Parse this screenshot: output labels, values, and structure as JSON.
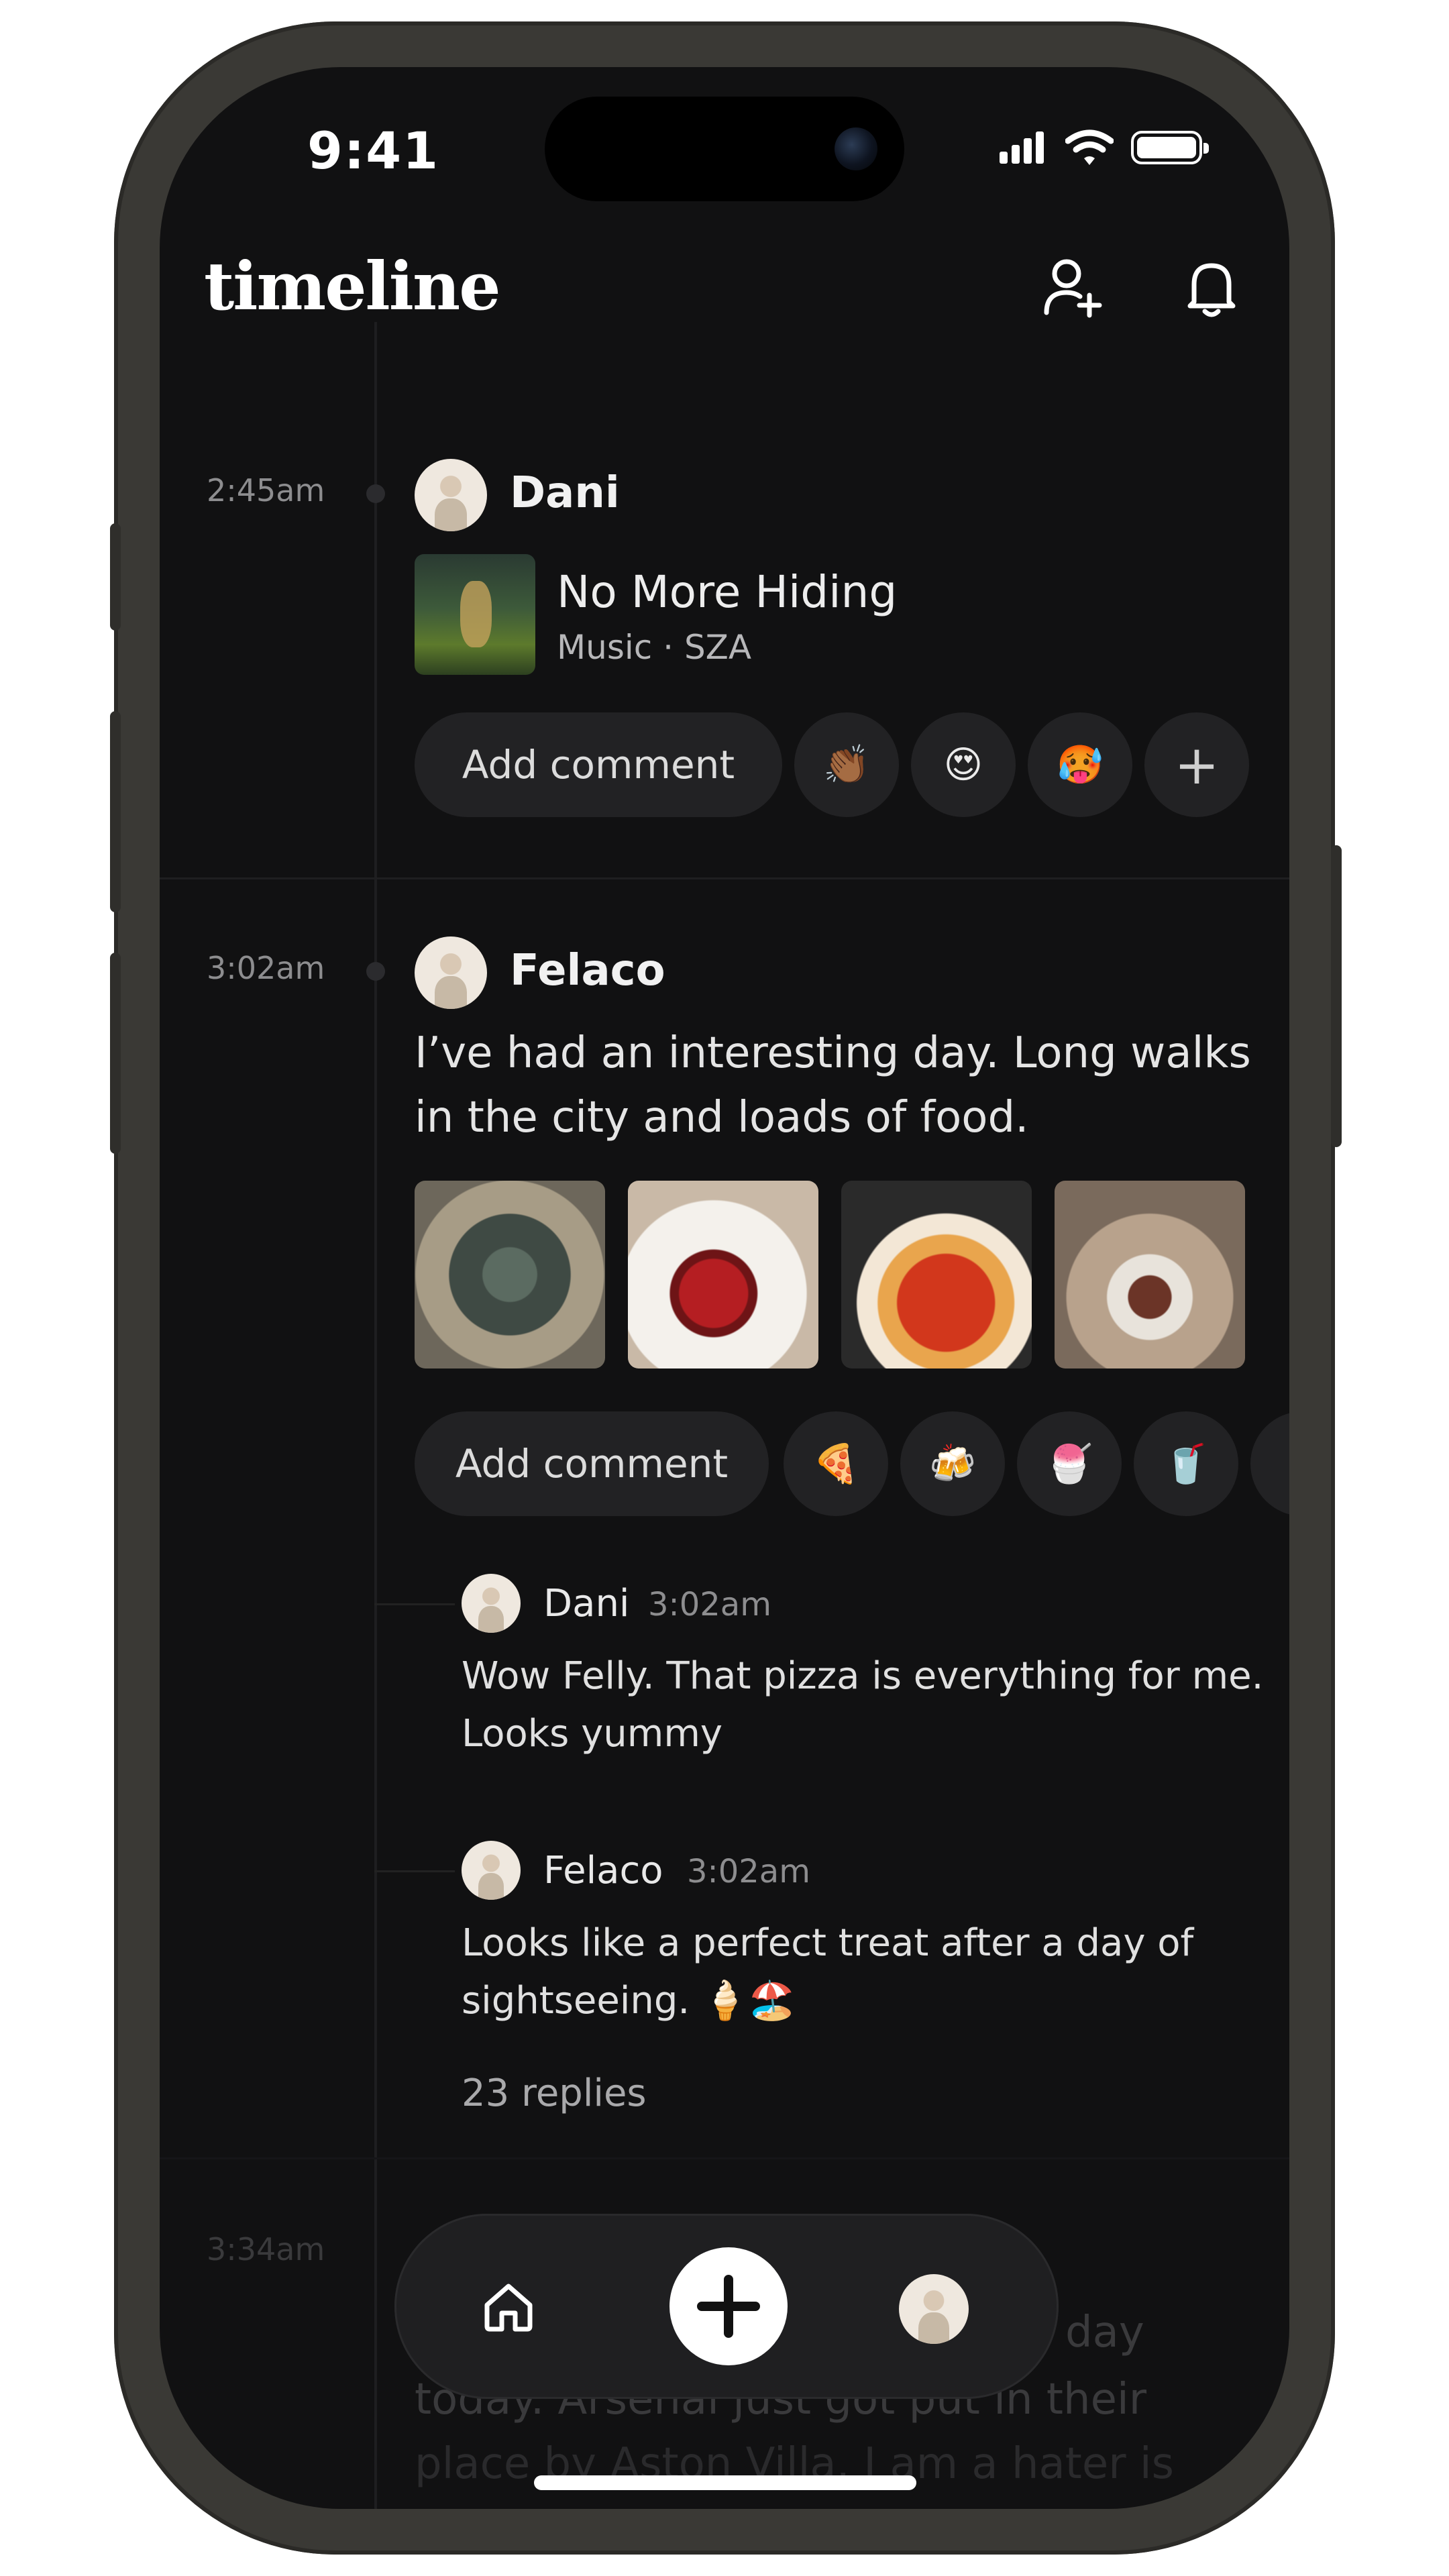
{
  "status_bar": {
    "time": "9:41"
  },
  "header": {
    "title": "timeline"
  },
  "posts": [
    {
      "time": "2:45am",
      "author": "Dani",
      "music": {
        "title": "No More Hiding",
        "subtitle": "Music · SZA"
      },
      "add_comment_label": "Add comment",
      "reactions": [
        "👏🏾",
        "😍",
        "🥵"
      ],
      "add_reaction_label": "+"
    },
    {
      "time": "3:02am",
      "author": "Felaco",
      "text_line1": "I’ve had an interesting day. Long walks",
      "text_line2": "in the city and loads of food.",
      "add_comment_label": "Add comment",
      "reactions": [
        "🍕",
        "🍻",
        "🍧",
        "🥤"
      ],
      "comments": [
        {
          "author": "Dani",
          "time": "3:02am",
          "line1": "Wow Felly. That pizza is everything for me.",
          "line2": "Looks yummy"
        },
        {
          "author": "Felaco",
          "time": "3:02am",
          "line1": "Looks like a perfect treat after a day of",
          "line2": "sightseeing. 🍦🏖️"
        }
      ],
      "replies_label": "23 replies"
    },
    {
      "time": "3:34am",
      "text_line1": "day",
      "text_line2": "today. Arsenal just got put in their",
      "text_line3": "place by Aston Villa. I am a hater is"
    }
  ]
}
